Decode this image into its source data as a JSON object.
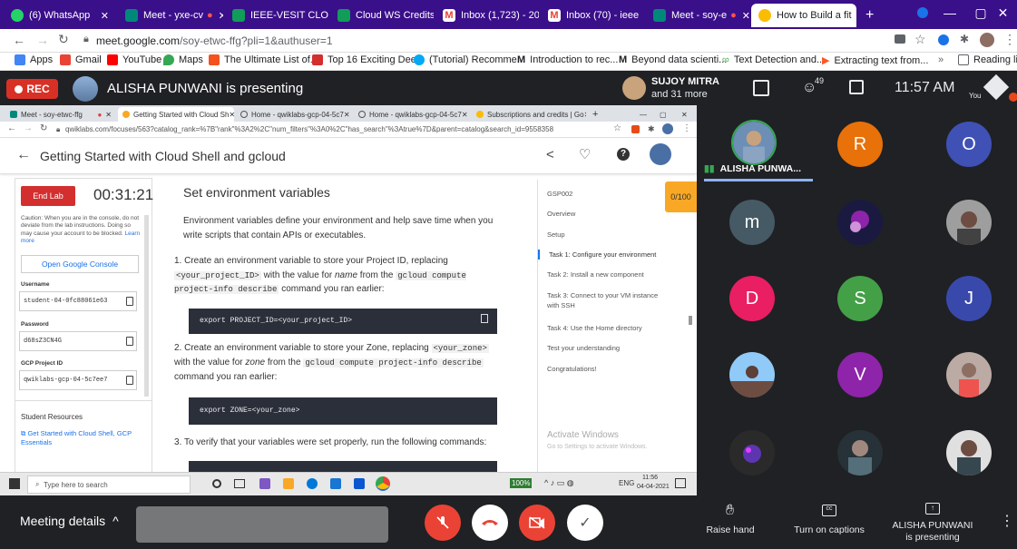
{
  "outer_tabs": [
    {
      "title": "(6) WhatsApp",
      "color": "#25d366"
    },
    {
      "title": "Meet - yxe-cv",
      "color": "#00897b"
    },
    {
      "title": "IEEE-VESIT CLOUD",
      "color": "#0f9d58"
    },
    {
      "title": "Cloud WS Credits",
      "color": "#0f9d58"
    },
    {
      "title": "Inbox (1,723) - 20",
      "color": "#ea4335"
    },
    {
      "title": "Inbox (70) - ieee",
      "color": "#ea4335"
    },
    {
      "title": "Meet - soy-e",
      "color": "#00897b"
    },
    {
      "title": "How to Build a fit",
      "color": "#fbbc04"
    }
  ],
  "outer_address": {
    "domain": "meet.google.com",
    "path": "/soy-etwc-ffg?pli=1&authuser=1"
  },
  "bookmarks": [
    {
      "label": "Apps",
      "color": "#4285f4"
    },
    {
      "label": "Gmail",
      "color": "#ea4335"
    },
    {
      "label": "YouTube",
      "color": "#ff0000"
    },
    {
      "label": "Maps",
      "color": "#34a853"
    },
    {
      "label": "The Ultimate List of...",
      "color": "#f4511e"
    },
    {
      "label": "Top 16 Exciting Dee...",
      "color": "#d32f2f"
    },
    {
      "label": "(Tutorial) Recomme...",
      "color": "#03a9f4"
    },
    {
      "label": "Introduction to rec...",
      "color": "#000000"
    },
    {
      "label": "Beyond data scienti...",
      "color": "#000000"
    },
    {
      "label": "Text Detection and...",
      "color": "#4caf50"
    },
    {
      "label": "Extracting text from...",
      "color": "#ff5722"
    },
    {
      "label": "Reading list",
      "color": "#5f6368"
    }
  ],
  "meet": {
    "rec_label": "REC",
    "presenter_banner": "ALISHA PUNWANI is presenting",
    "user_name": "SUJOY MITRA",
    "user_sub": "and 31 more",
    "participant_count": "49",
    "time": "11:57 AM",
    "you_label": "You"
  },
  "inner_tabs": [
    "Meet - soy-etwc-ffg",
    "Getting Started with Cloud Sh",
    "Home - qwiklabs-gcp-04-5c7",
    "Home - qwiklabs-gcp-04-5c7",
    "Subscriptions and credits | Go"
  ],
  "inner_address": "qwiklabs.com/focuses/563?catalog_rank=%7B\"rank\"%3A2%2C\"num_filters\"%3A0%2C\"has_search\"%3Atrue%7D&parent=catalog&search_id=9558358",
  "lab": {
    "title": "Getting Started with Cloud Shell and gcloud",
    "end_lab": "End Lab",
    "timer": "00:31:21",
    "caution": "Caution: When you are in the console, do not deviate from the lab instructions. Doing so may cause your account to be blocked.",
    "learn_more": "Learn more",
    "open_console": "Open Google Console",
    "username_label": "Username",
    "username": "student-04-0fc88061e63",
    "password_label": "Password",
    "password": "d68sZ3CN4G",
    "project_label": "GCP Project ID",
    "project": "qwiklabs-gcp-04-5c7ee7",
    "resources_label": "Student Resources",
    "resource_link": "Get Started with Cloud Shell, GCP Essentials",
    "score": "0/100"
  },
  "content": {
    "heading": "Set environment variables",
    "intro": "Environment variables define your environment and help save time when you write scripts that contain APIs or executables.",
    "step1_a": "1. Create an environment variable to store your Project ID, replacing",
    "step1_code1": "<your_project_ID>",
    "step1_b": "with the value for",
    "step1_em": "name",
    "step1_c": "from the",
    "step1_code2": "gcloud compute project-info describe",
    "step1_d": "command you ran earlier:",
    "code1": "export PROJECT_ID=<your_project_ID>",
    "step2_a": "2. Create an environment variable to store your Zone, replacing",
    "step2_code1": "<your_zone>",
    "step2_b": "with the value for",
    "step2_em": "zone",
    "step2_c": "from the",
    "step2_code2": "gcloud compute project-info describe",
    "step2_d": "command you ran earlier:",
    "code2": "export ZONE=<your_zone>",
    "step3": "3. To verify that your variables were set properly, run the following commands:"
  },
  "nav": [
    "GSP002",
    "Overview",
    "Setup",
    "Task 1: Configure your environment",
    "Task 2: Install a new component",
    "Task 3: Connect to your VM instance with SSH",
    "Task 4: Use the Home directory",
    "Test your understanding",
    "Congratulations!"
  ],
  "watermark": {
    "title": "Activate Windows",
    "sub": "Go to Settings to activate Windows."
  },
  "taskbar": {
    "search": "Type here to search",
    "zoom": "100%",
    "lang": "ENG",
    "time": "11:56",
    "date": "04-04-2021"
  },
  "participants": {
    "presenter_name": "ALISHA PUNWA...",
    "letters": [
      "R",
      "O",
      "m",
      "D",
      "S",
      "J",
      "V"
    ]
  },
  "bottom": {
    "meeting_details": "Meeting details",
    "raise_hand": "Raise hand",
    "captions": "Turn on captions",
    "presenting_name": "ALISHA PUNWANI",
    "presenting_sub": "is presenting"
  }
}
